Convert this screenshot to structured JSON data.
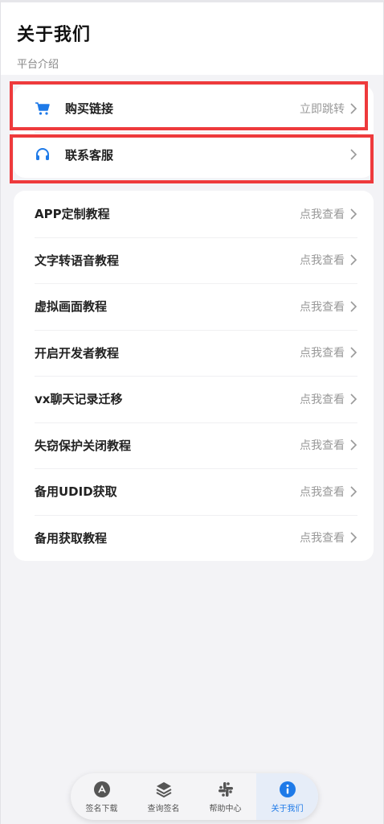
{
  "header": {
    "title": "关于我们",
    "subtitle": "平台介绍"
  },
  "top_card": [
    {
      "icon": "cart-icon",
      "label": "购买链接",
      "right": "立即跳转"
    },
    {
      "icon": "headset-icon",
      "label": "联系客服",
      "right": ""
    }
  ],
  "tutorials": {
    "action_label": "点我查看",
    "items": [
      "APP定制教程",
      "文字转语音教程",
      "虚拟画面教程",
      "开启开发者教程",
      "vx聊天记录迁移",
      "失窃保护关闭教程",
      "备用UDID获取",
      "备用获取教程"
    ]
  },
  "tabbar": {
    "tabs": [
      {
        "label": "签名下载",
        "icon": "app-store-icon"
      },
      {
        "label": "查询签名",
        "icon": "layers-icon"
      },
      {
        "label": "帮助中心",
        "icon": "slack-icon"
      },
      {
        "label": "关于我们",
        "icon": "info-icon"
      }
    ],
    "active_index": 3
  },
  "colors": {
    "accent": "#1e7ae8",
    "highlight": "#ee3a3c"
  }
}
